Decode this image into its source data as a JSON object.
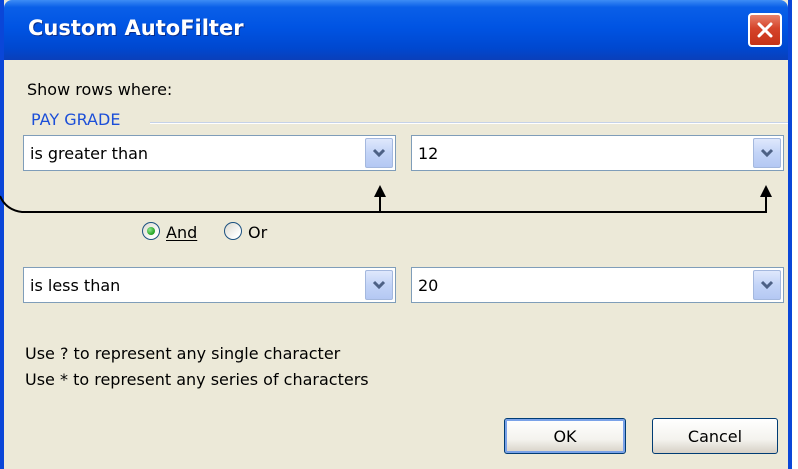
{
  "dialog": {
    "title": "Custom AutoFilter",
    "prompt": "Show rows where:",
    "field_name": "PAY GRADE"
  },
  "criteria": [
    {
      "operator": "is greater than",
      "value": "12"
    },
    {
      "operator": "is less than",
      "value": "20"
    }
  ],
  "logic": {
    "and_label": "And",
    "or_label": "Or",
    "selected": "And"
  },
  "hints": {
    "single_char": "Use ? to represent any single character",
    "series_chars": "Use * to represent any series of characters"
  },
  "buttons": {
    "ok": "OK",
    "cancel": "Cancel"
  },
  "colors": {
    "title_bar": "#0054e3",
    "window_bg": "#ece9d8",
    "field_label": "#1c4fd8",
    "close_button": "#d5442a"
  },
  "icons": {
    "close": "close-icon",
    "dropdown": "chevron-down-icon",
    "annotation": "arrow-up-icon"
  }
}
